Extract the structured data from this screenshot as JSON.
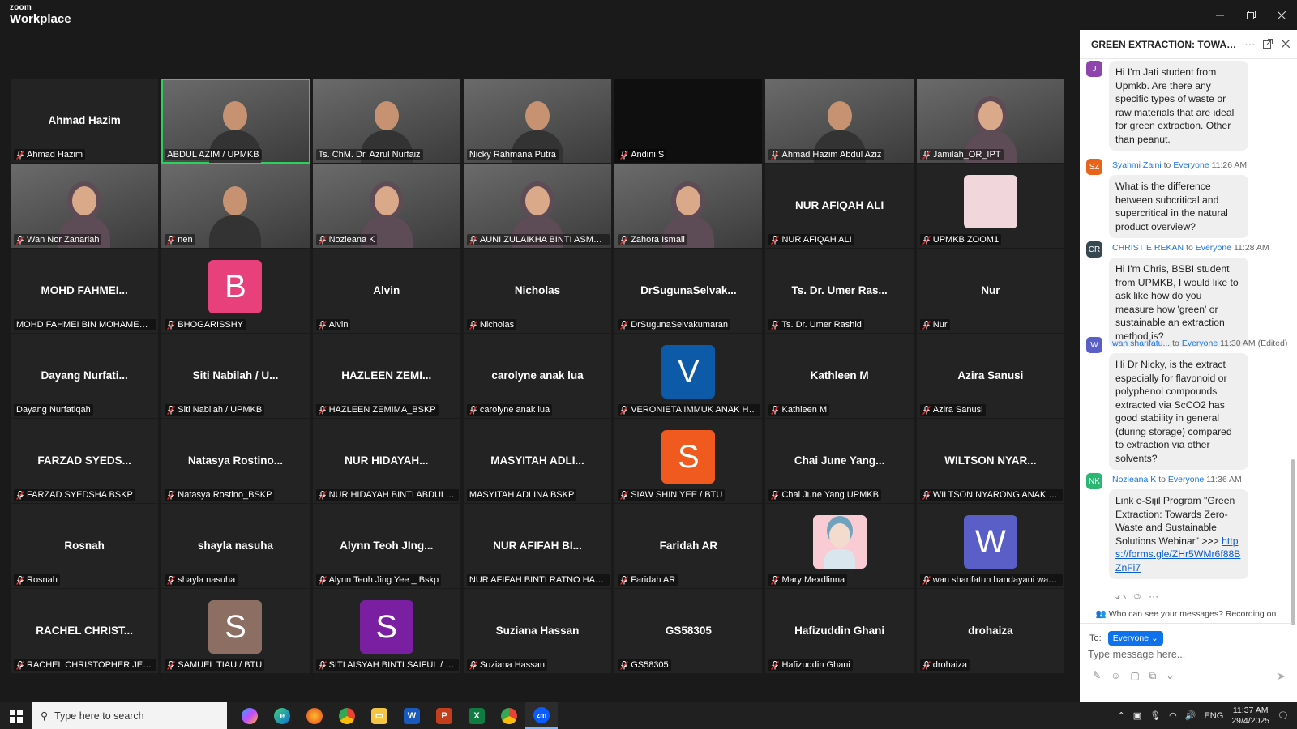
{
  "app": {
    "brand_top": "zoom",
    "brand_bottom": "Workplace"
  },
  "participants": [
    {
      "big": "Ahmad Hazim",
      "label": "Ahmad Hazim",
      "muted": true
    },
    {
      "big": "",
      "label": "ABDUL AZIM / UPMKB",
      "muted": false,
      "video": true,
      "active": true
    },
    {
      "big": "",
      "label": "Ts. ChM. Dr. Azrul Nurfaiz",
      "muted": false,
      "video": true
    },
    {
      "big": "",
      "label": "Nicky Rahmana Putra",
      "muted": false,
      "video": true
    },
    {
      "big": "",
      "label": "Andini S",
      "muted": true,
      "blank": true
    },
    {
      "big": "",
      "label": "Ahmad Hazim Abdul Aziz",
      "muted": true,
      "video": true
    },
    {
      "big": "",
      "label": "Jamilah_OR_IPT",
      "muted": true,
      "video": true,
      "hijab": true
    },
    {
      "big": "",
      "label": "Wan Nor Zanariah",
      "muted": true,
      "video": true,
      "hijab": true
    },
    {
      "big": "",
      "label": "nen",
      "muted": true,
      "video": true
    },
    {
      "big": "",
      "label": "Nozieana K",
      "muted": true,
      "video": true,
      "hijab": true
    },
    {
      "big": "",
      "label": "AUNI ZULAIKHA BINTI ASMAWI /...",
      "muted": true,
      "video": true,
      "hijab": true
    },
    {
      "big": "",
      "label": "Zahora Ismail",
      "muted": true,
      "video": true,
      "hijab": true
    },
    {
      "big": "NUR AFIQAH ALI",
      "label": "NUR AFIQAH ALI",
      "muted": true
    },
    {
      "big": "",
      "label": "UPMKB ZOOM1",
      "muted": true,
      "photo": true
    },
    {
      "big": "MOHD  FAHMEI...",
      "label": "MOHD FAHMEI BIN MOHAMED HU...",
      "muted": false
    },
    {
      "big": "",
      "label": "BHOGARISSHY",
      "muted": true,
      "letter": "B",
      "color": "#e8407a"
    },
    {
      "big": "Alvin",
      "label": "Alvin",
      "muted": true
    },
    {
      "big": "Nicholas",
      "label": "Nicholas",
      "muted": true
    },
    {
      "big": "DrSugunaSelvak...",
      "label": "DrSugunaSelvakumaran",
      "muted": true
    },
    {
      "big": "Ts. Dr. Umer Ras...",
      "label": "Ts. Dr. Umer Rashid",
      "muted": true
    },
    {
      "big": "Nur",
      "label": "Nur",
      "muted": true
    },
    {
      "big": "Dayang  Nurfati...",
      "label": "Dayang Nurfatiqah",
      "muted": false
    },
    {
      "big": "Siti Nabilah / U...",
      "label": "Siti Nabilah / UPMKB",
      "muted": true
    },
    {
      "big": "HAZLEEN  ZEMI...",
      "label": "HAZLEEN ZEMIMA_BSKP",
      "muted": true
    },
    {
      "big": "carolyne anak lua",
      "label": "carolyne anak lua",
      "muted": true
    },
    {
      "big": "",
      "label": "VERONIETA IMMUK ANAK HARR...",
      "muted": true,
      "letter": "V",
      "color": "#0d5aa8"
    },
    {
      "big": "Kathleen M",
      "label": "Kathleen M",
      "muted": true
    },
    {
      "big": "Azira Sanusi",
      "label": "Azira Sanusi",
      "muted": true
    },
    {
      "big": "FARZAD  SYEDS...",
      "label": "FARZAD SYEDSHA BSKP",
      "muted": true
    },
    {
      "big": "Natasya  Rostino...",
      "label": "Natasya Rostino_BSKP",
      "muted": true
    },
    {
      "big": "NUR HIDAYAH...",
      "label": "NUR HIDAYAH BINTI ABDUL HALI...",
      "muted": true
    },
    {
      "big": "MASYITAH  ADLI...",
      "label": "MASYITAH ADLINA BSKP",
      "muted": false
    },
    {
      "big": "",
      "label": "SIAW SHIN YEE / BTU",
      "muted": true,
      "letter": "S",
      "color": "#f05a1e"
    },
    {
      "big": "Chai June Yang...",
      "label": "Chai June Yang UPMKB",
      "muted": true
    },
    {
      "big": "WILTSON  NYAR...",
      "label": "WILTSON NYARONG ANAK JOST...",
      "muted": true
    },
    {
      "big": "Rosnah",
      "label": "Rosnah",
      "muted": true
    },
    {
      "big": "shayla nasuha",
      "label": "shayla nasuha",
      "muted": true
    },
    {
      "big": "Alynn Teoh JIng...",
      "label": "Alynn Teoh Jing Yee _ Bskp",
      "muted": true
    },
    {
      "big": "NUR AFIFAH BI...",
      "label": "NUR AFIFAH BINTI RATNO HADIYO...",
      "muted": false
    },
    {
      "big": "Faridah AR",
      "label": "Faridah AR",
      "muted": true
    },
    {
      "big": "",
      "label": "Mary Mexdlinna",
      "muted": true,
      "cartoon": true
    },
    {
      "big": "",
      "label": "wan sharifatun handayani wan z...",
      "muted": true,
      "letter": "W",
      "color": "#5a5fc7"
    },
    {
      "big": "RACHEL CHRIST...",
      "label": "RACHEL CHRISTOPHER JERRY / ...",
      "muted": true
    },
    {
      "big": "",
      "label": "SAMUEL TIAU / BTU",
      "muted": true,
      "letter": "S",
      "color": "#8d6e63"
    },
    {
      "big": "",
      "label": "SITI AISYAH BINTI SAIFUL / UPM",
      "muted": true,
      "letter": "S",
      "color": "#7b1fa2"
    },
    {
      "big": "Suziana Hassan",
      "label": "Suziana Hassan",
      "muted": true
    },
    {
      "big": "GS58305",
      "label": "GS58305",
      "muted": true
    },
    {
      "big": "Hafizuddin Ghani",
      "label": "Hafizuddin Ghani",
      "muted": true
    },
    {
      "big": "drohaiza",
      "label": "drohaiza",
      "muted": true
    }
  ],
  "chat": {
    "title": "GREEN EXTRACTION: TOWARDS ...",
    "messages": [
      {
        "initials": "J",
        "color": "#8e44ad",
        "sender": "",
        "to": "",
        "recipient": "",
        "time": "",
        "text": "Hi I'm Jati student from Upmkb. Are there any specific types of waste or raw materials that are ideal for green extraction. Other than peanut."
      },
      {
        "initials": "SZ",
        "color": "#e8641b",
        "sender": "Syahmi Zaini",
        "to": "to",
        "recipient": "Everyone",
        "time": "11:26 AM",
        "text": "What is the difference between subcritical and supercritical in the natural product overview?"
      },
      {
        "initials": "CR",
        "color": "#37474f",
        "sender": "CHRISTIE REKAN",
        "to": "to",
        "recipient": "Everyone",
        "time": "11:28 AM",
        "text": "Hi I'm Chris, BSBI student from UPMKB, I would like to ask like how do you measure how 'green' or sustainable an extraction method is?"
      },
      {
        "initials": "W",
        "color": "#5a5fc7",
        "sender": "wan sharifatu...",
        "to": "to",
        "recipient": "Everyone",
        "time": "11:30 AM (Edited)",
        "text": "Hi Dr Nicky, is the extract especially for flavonoid or polyphenol compounds extracted via ScCO2 has good stability in general (during storage) compared to extraction via other solvents?"
      },
      {
        "initials": "NK",
        "color": "#2bb673",
        "sender": "Nozieana K",
        "to": "to",
        "recipient": "Everyone",
        "time": "11:36 AM",
        "text": "Link e-Sijil Program \"Green Extraction: Towards Zero-Waste and Sustainable Solutions Webinar\" >>>",
        "link": "https://forms.gle/ZHr5WMr6f88BZnFi7"
      }
    ],
    "notice": "Who can see your messages? Recording on",
    "to_label": "To:",
    "to_value": "Everyone",
    "input_placeholder": "Type message here..."
  },
  "taskbar": {
    "search_placeholder": "Type here to search",
    "lang": "ENG",
    "time": "11:37 AM",
    "date": "29/4/2025"
  }
}
